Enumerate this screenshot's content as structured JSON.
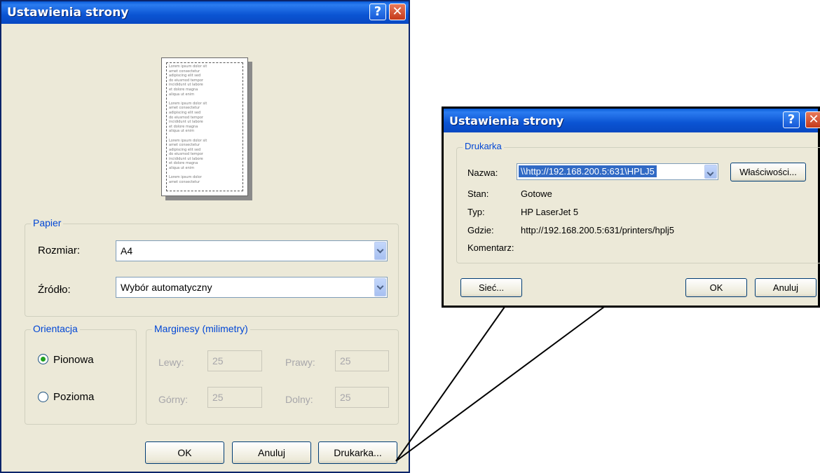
{
  "main_dialog": {
    "title": "Ustawienia strony",
    "help_glyph": "?",
    "close_glyph": "✕",
    "preview_lines": [
      "Lorem ipsum dolor sit",
      "amet consectetur",
      "adipiscing elit sed",
      "do eiusmod tempor",
      "incididunt ut labore",
      "et dolore magna",
      "aliqua ut enim",
      "",
      "Lorem ipsum dolor sit",
      "amet consectetur",
      "adipiscing elit sed",
      "do eiusmod tempor",
      "incididunt ut labore",
      "et dolore magna",
      "aliqua ut enim",
      "",
      "Lorem ipsum dolor sit",
      "amet consectetur",
      "adipiscing elit sed",
      "do eiusmod tempor",
      "incididunt ut labore",
      "et dolore magna",
      "aliqua ut enim",
      "",
      "Lorem ipsum dolor",
      "amet consectetur"
    ],
    "paper": {
      "group_label": "Papier",
      "size_label": "Rozmiar:",
      "size_value": "A4",
      "source_label": "Źródło:",
      "source_value": "Wybór automatyczny"
    },
    "orientation": {
      "group_label": "Orientacja",
      "portrait": "Pionowa",
      "landscape": "Pozioma",
      "selected": "portrait"
    },
    "margins": {
      "group_label": "Marginesy (milimetry)",
      "left_label": "Lewy:",
      "left_value": "25",
      "right_label": "Prawy:",
      "right_value": "25",
      "top_label": "Górny:",
      "top_value": "25",
      "bottom_label": "Dolny:",
      "bottom_value": "25"
    },
    "buttons": {
      "ok": "OK",
      "cancel": "Anuluj",
      "printer": "Drukarka..."
    }
  },
  "printer_dialog": {
    "title": "Ustawienia strony",
    "help_glyph": "?",
    "close_glyph": "✕",
    "group_label": "Drukarka",
    "name_label": "Nazwa:",
    "name_value": "\\\\http://192.168.200.5:631\\HPLJ5",
    "properties_button": "Właściwości...",
    "status_label": "Stan:",
    "status_value": "Gotowe",
    "type_label": "Typ:",
    "type_value": "HP LaserJet 5",
    "where_label": "Gdzie:",
    "where_value": "http://192.168.200.5:631/printers/hplj5",
    "comment_label": "Komentarz:",
    "network_button": "Sieć...",
    "ok_button": "OK",
    "cancel_button": "Anuluj"
  },
  "colors": {
    "titlebar": "#0a5bd6",
    "dialog_bg": "#ece9d8",
    "group_label": "#0046d5",
    "selection": "#316ac5",
    "disabled_text": "#a7a6aa"
  }
}
